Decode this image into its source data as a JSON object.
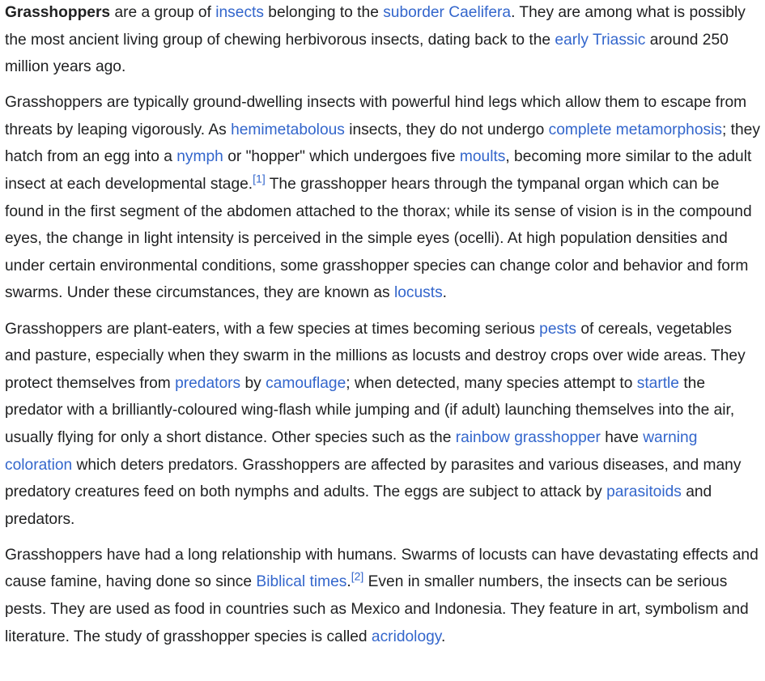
{
  "paragraphs": [
    [
      {
        "t": "b",
        "v": "Grasshoppers",
        "name": "article-subject-bold"
      },
      {
        "t": "s",
        "v": " are a group of "
      },
      {
        "t": "l",
        "v": "insects",
        "name": "link-insects"
      },
      {
        "t": "s",
        "v": " belonging to the "
      },
      {
        "t": "l",
        "v": "suborder Caelifera",
        "name": "link-suborder-caelifera"
      },
      {
        "t": "s",
        "v": ". They are among what is possibly the most ancient living group of chewing herbivorous insects, dating back to the "
      },
      {
        "t": "l",
        "v": "early Triassic",
        "name": "link-early-triassic"
      },
      {
        "t": "s",
        "v": " around 250 million years ago."
      }
    ],
    [
      {
        "t": "s",
        "v": "Grasshoppers are typically ground-dwelling insects with powerful hind legs which allow them to escape from threats by leaping vigorously. As "
      },
      {
        "t": "l",
        "v": "hemimetabolous",
        "name": "link-hemimetabolous"
      },
      {
        "t": "s",
        "v": " insects, they do not undergo "
      },
      {
        "t": "l",
        "v": "complete metamorphosis",
        "name": "link-complete-metamorphosis"
      },
      {
        "t": "s",
        "v": "; they hatch from an egg into a "
      },
      {
        "t": "l",
        "v": "nymph",
        "name": "link-nymph"
      },
      {
        "t": "s",
        "v": " or \"hopper\" which undergoes five "
      },
      {
        "t": "l",
        "v": "moults",
        "name": "link-moults"
      },
      {
        "t": "s",
        "v": ", becoming more similar to the adult insect at each developmental stage."
      },
      {
        "t": "r",
        "v": "[1]",
        "name": "citation-1"
      },
      {
        "t": "s",
        "v": " The grasshopper hears through the tympanal organ which can be found in the first segment of the abdomen attached to the thorax; while its sense of vision is in the compound eyes, the change in light intensity is perceived in the simple eyes (ocelli). At high population densities and under certain environmental conditions, some grasshopper species can change color and behavior and form swarms. Under these circumstances, they are known as "
      },
      {
        "t": "l",
        "v": "locusts",
        "name": "link-locusts"
      },
      {
        "t": "s",
        "v": "."
      }
    ],
    [
      {
        "t": "s",
        "v": "Grasshoppers are plant-eaters, with a few species at times becoming serious "
      },
      {
        "t": "l",
        "v": "pests",
        "name": "link-pests"
      },
      {
        "t": "s",
        "v": " of cereals, vegetables and pasture, especially when they swarm in the millions as locusts and destroy crops over wide areas. They protect themselves from "
      },
      {
        "t": "l",
        "v": "predators",
        "name": "link-predators"
      },
      {
        "t": "s",
        "v": " by "
      },
      {
        "t": "l",
        "v": "camouflage",
        "name": "link-camouflage"
      },
      {
        "t": "s",
        "v": "; when detected, many species attempt to "
      },
      {
        "t": "l",
        "v": "startle",
        "name": "link-startle"
      },
      {
        "t": "s",
        "v": " the predator with a brilliantly-coloured wing-flash while jumping and (if adult) launching themselves into the air, usually flying for only a short distance. Other species such as the "
      },
      {
        "t": "l",
        "v": "rainbow grasshopper",
        "name": "link-rainbow-grasshopper"
      },
      {
        "t": "s",
        "v": " have "
      },
      {
        "t": "l",
        "v": "warning coloration",
        "name": "link-warning-coloration"
      },
      {
        "t": "s",
        "v": " which deters predators. Grasshoppers are affected by parasites and various diseases, and many predatory creatures feed on both nymphs and adults. The eggs are subject to attack by "
      },
      {
        "t": "l",
        "v": "parasitoids",
        "name": "link-parasitoids"
      },
      {
        "t": "s",
        "v": " and predators."
      }
    ],
    [
      {
        "t": "s",
        "v": "Grasshoppers have had a long relationship with humans. Swarms of locusts can have devastating effects and cause famine, having done so since "
      },
      {
        "t": "l",
        "v": "Biblical times",
        "name": "link-biblical-times"
      },
      {
        "t": "s",
        "v": "."
      },
      {
        "t": "r",
        "v": "[2]",
        "name": "citation-2"
      },
      {
        "t": "s",
        "v": " Even in smaller numbers, the insects can be serious pests. They are used as food in countries such as Mexico and Indonesia. They feature in art, symbolism and literature. The study of grasshopper species is called "
      },
      {
        "t": "l",
        "v": "acridology",
        "name": "link-acridology"
      },
      {
        "t": "s",
        "v": "."
      }
    ]
  ],
  "colors": {
    "text": "#202122",
    "link": "#3366cc",
    "background": "#ffffff"
  }
}
